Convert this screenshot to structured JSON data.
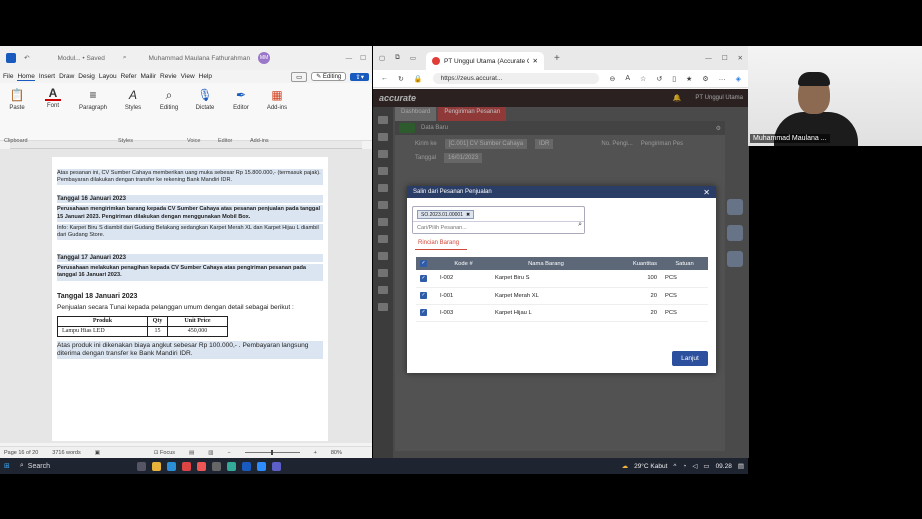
{
  "word": {
    "title_doc": "Modul... • Saved",
    "title_user": "Muhammad Maulana Fathurahman",
    "user_initials": "MM",
    "menu": [
      "File",
      "Home",
      "Insert",
      "Draw",
      "Design",
      "Layout",
      "References",
      "Mailings",
      "Review",
      "View",
      "Help"
    ],
    "menu_display": [
      "File",
      "Home",
      "Insert",
      "Draw",
      "Desig",
      "Layou",
      "Refer",
      "Mailir",
      "Revie",
      "View",
      "Help"
    ],
    "editing_label": "Editing",
    "ribbon": [
      "Paste",
      "Font",
      "Paragraph",
      "Styles",
      "Editing",
      "Dictate",
      "Editor",
      "Add-ins"
    ],
    "ribbon_groups": [
      "Clipboard",
      "Styles",
      "Voice",
      "Editor",
      "Add-ins"
    ],
    "doc": {
      "p1": "Atas pesanan ini, CV Sumber Cahaya memberikan uang muka sebesar Rp 15.800.000,- (termasuk pajak). Pembayaran dilakukan dengan transfer ke rekening Bank Mandiri IDR.",
      "h1": "Tanggal 16 Januari 2023",
      "p2": "Perusahaan mengirimkan barang kepada CV Sumber Cahaya atas pesanan penjualan pada tanggal 15 Januari 2023. Pengiriman dilakukan dengan menggunakan Mobil Box.",
      "p3": "Info: Karpet Biru S diambil dari Gudang Belakang sedangkan Karpet Merah XL dan Karpet Hijau L diambil dari Gudang Store.",
      "h2": "Tanggal 17 Januari 2023",
      "p4": "Perusahaan melakukan penagihan kepada CV Sumber Cahaya atas pengiriman pesanan pada tanggal 16 Januari 2023.",
      "h3": "Tanggal 18 Januari 2023",
      "p5": "Penjualan secara Tunai kepada pelanggan umum dengan detail sebagai berikut :",
      "table_headers": [
        "Produk",
        "Qty",
        "Unit Price"
      ],
      "table_rows": [
        [
          "Lampu Hias LED",
          "15",
          "450,000"
        ]
      ],
      "p6": "Atas produk ini dikenakan biaya angkut sebesar Rp 100.000,- . Pembayaran langsung diterima dengan transfer ke Bank Mandiri IDR."
    },
    "status": {
      "page": "Page 16 of 20",
      "words": "3716 words",
      "focus": "Focus",
      "zoom": "80%"
    }
  },
  "browser": {
    "tab_title": "PT Unggul Utama (Accurate Onli",
    "url": "https://zeus.accurat...",
    "app_logo": "accurate",
    "company": "PT Unggul Utama",
    "tabs": [
      "Dashboard",
      "Pengiriman Pesanan"
    ],
    "breadcrumb": "Data Baru",
    "kirim_ke_label": "Kirim ke",
    "kirim_ke_value": "[C.001] CV Sumber Cahaya",
    "currency": "IDR",
    "tanggal_label": "Tanggal",
    "tanggal_value": "16/01/2023",
    "no_pengiriman": "No. Pengi...",
    "pengiriman_pes": "Pengiriman Pes"
  },
  "modal": {
    "title": "Salin dari Pesanan Penjualan",
    "chip": "SO.2023.01.00001",
    "search_placeholder": "Cari/Pilih Pesanan...",
    "tab": "Rincian Barang",
    "headers": [
      "Kode #",
      "Nama Barang",
      "Kuantitas",
      "Satuan"
    ],
    "rows": [
      {
        "code": "I-002",
        "name": "Karpet Biru S",
        "qty": "100",
        "unit": "PCS"
      },
      {
        "code": "I-001",
        "name": "Karpet Merah XL",
        "qty": "20",
        "unit": "PCS"
      },
      {
        "code": "I-003",
        "name": "Karpet Hijau L",
        "qty": "20",
        "unit": "PCS"
      }
    ],
    "button": "Lanjut"
  },
  "webcam": {
    "name": "Muhammad Maulana ..."
  },
  "taskbar": {
    "search": "Search",
    "weather": "29°C  Kabut",
    "time": "09.28"
  }
}
